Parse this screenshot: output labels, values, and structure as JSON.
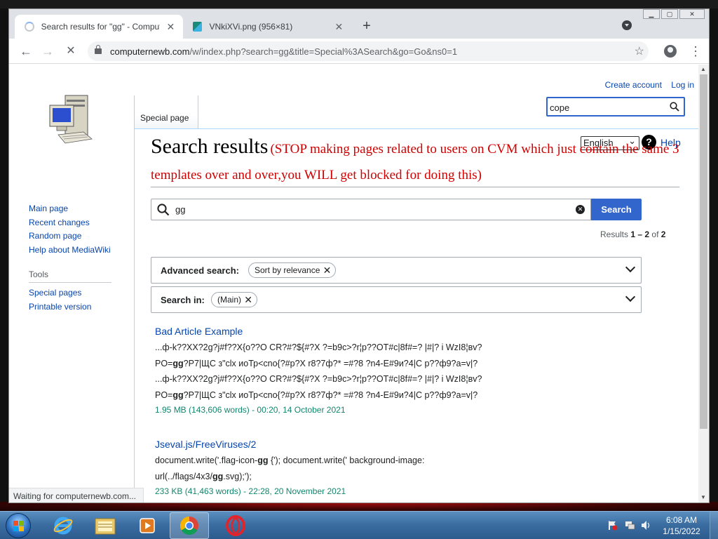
{
  "browser": {
    "tabs": [
      {
        "title": "Search results for \"gg\" - Comput",
        "close": "✕"
      },
      {
        "title": "VNkiXVi.png (956×81)",
        "close": "✕"
      }
    ],
    "new_tab": "+",
    "url_host": "computernewb.com",
    "url_path": "/w/index.php?search=gg&title=Special%3ASearch&go=Go&ns0=1",
    "status": "Waiting for computernewb.com..."
  },
  "wiki": {
    "personal": {
      "create_account": "Create account",
      "log_in": "Log in"
    },
    "namespace_tab": "Special page",
    "search_box_value": "cope",
    "sidebar": {
      "nav": [
        "Main page",
        "Recent changes",
        "Random page",
        "Help about MediaWiki"
      ],
      "tools_heading": "Tools",
      "tools": [
        "Special pages",
        "Printable version"
      ]
    },
    "language": "English",
    "help": "Help",
    "title": "Search results",
    "notice": "(STOP making pages related to users on CVM which just contain the same 3 templates over and over,you WILL get blocked for doing this)",
    "query": "gg",
    "search_button": "Search",
    "results_info": {
      "prefix": "Results ",
      "range": "1 – 2",
      "of": " of ",
      "total": "2"
    },
    "advanced": {
      "label": "Advanced search:",
      "chip": "Sort by relevance"
    },
    "search_in": {
      "label": "Search in:",
      "chip": "(Main)"
    },
    "results": [
      {
        "title": "Bad Article Example",
        "snippet": [
          "...ф-k??XX?2g?j#f??X{o??O CR?#?${#?X ?=b9c>?r¦p??OT#c|8f#=? |#|? i WzI8¦вv?",
          "PO=[gg]?P7|ЩС з\"clx иоТр<cno{?#p?X r8?7ф?* =#?8 ?n4-E#9и?4|C p??ф9?a=v|?",
          "...ф-k??XX?2g?j#f??X{o??O CR?#?${#?X ?=b9c>?r¦p??OT#c|8f#=? |#|? i WzI8¦вv?",
          "PO=[gg]?P7|ЩС з\"clx иоТр<cno{?#p?X r8?7ф?* =#?8 ?n4-E#9и?4|C p??ф9?a=v|?"
        ],
        "meta": "1.95 MB (143,606 words) - 00:20, 14 October 2021"
      },
      {
        "title": "Jseval.js/FreeViruses/2",
        "snippet": [
          "document.write('.flag-icon-[gg] {'); document.write(' background-image:",
          "url(../flags/4x3/[gg].svg);');"
        ],
        "meta": "233 KB (41,463 words) - 22:28, 20 November 2021"
      }
    ]
  },
  "taskbar": {
    "time": "6:08 AM",
    "date": "1/15/2022"
  },
  "colors": {
    "link": "#0645ad",
    "notice_red": "#d00000",
    "meta_green": "#14866d",
    "button_blue": "#3366cc",
    "taskbar_blue": "#3c6ea2"
  }
}
